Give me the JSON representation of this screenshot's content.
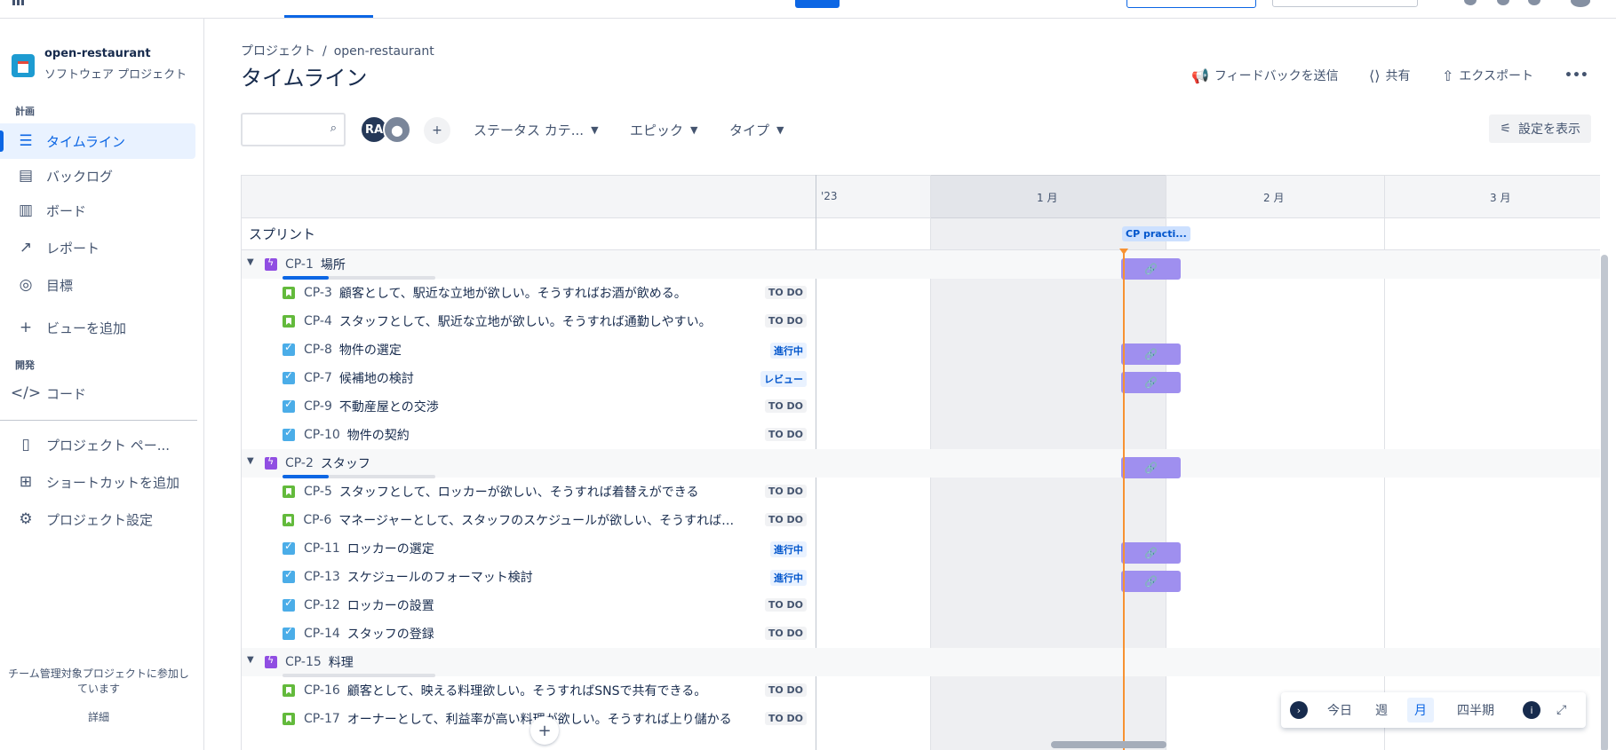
{
  "project": {
    "name": "open-restaurant",
    "type": "ソフトウェア プロジェクト"
  },
  "sidebar": {
    "section_plan": "計画",
    "section_dev": "開発",
    "items": [
      {
        "label": "タイムライン",
        "icon": "timeline-icon"
      },
      {
        "label": "バックログ",
        "icon": "backlog-icon"
      },
      {
        "label": "ボード",
        "icon": "board-icon"
      },
      {
        "label": "レポート",
        "icon": "reports-icon"
      },
      {
        "label": "目標",
        "icon": "goals-icon"
      },
      {
        "label": "ビューを追加",
        "icon": "plus-icon"
      },
      {
        "label": "コード",
        "icon": "code-icon"
      },
      {
        "label": "プロジェクト ペー...",
        "icon": "page-icon"
      },
      {
        "label": "ショートカットを追加",
        "icon": "add-shortcut-icon"
      },
      {
        "label": "プロジェクト設定",
        "icon": "gear-icon"
      }
    ],
    "footer_text": "チーム管理対象プロジェクトに参加しています",
    "footer_link": "詳細"
  },
  "header": {
    "breadcrumb_root": "プロジェクト",
    "breadcrumb_sep": "/",
    "breadcrumb_project": "open-restaurant",
    "title": "タイムライン",
    "feedback": "フィードバックを送信",
    "share": "共有",
    "export": "エクスポート",
    "more": "•••"
  },
  "filters": {
    "search_placeholder": "",
    "avatar_initials": "RA",
    "status_category": "ステータス カテ...",
    "epic": "エピック",
    "type": "タイプ",
    "show_settings": "設定を表示"
  },
  "timeline": {
    "months": [
      "'23",
      "1 月",
      "2 月",
      "3 月"
    ],
    "sprint_label": "スプリント",
    "sprint_chip": "CP practi...",
    "rows": [
      {
        "kind": "epic",
        "key": "CP-1",
        "summary": "場所",
        "progress": 0.3,
        "bar": true
      },
      {
        "kind": "story",
        "key": "CP-3",
        "summary": "顧客として、駅近な立地が欲しい。そうすればお酒が飲める。",
        "status": "TO DO",
        "status_kind": "todo",
        "bar": false
      },
      {
        "kind": "story",
        "key": "CP-4",
        "summary": "スタッフとして、駅近な立地が欲しい。そうすれば通勤しやすい。",
        "status": "TO DO",
        "status_kind": "todo",
        "bar": false
      },
      {
        "kind": "task",
        "key": "CP-8",
        "summary": "物件の選定",
        "status": "進行中",
        "status_kind": "progress-s",
        "bar": true
      },
      {
        "kind": "task",
        "key": "CP-7",
        "summary": "候補地の検討",
        "status": "レビュー",
        "status_kind": "review",
        "bar": true
      },
      {
        "kind": "task",
        "key": "CP-9",
        "summary": "不動産屋との交渉",
        "status": "TO DO",
        "status_kind": "todo",
        "bar": false
      },
      {
        "kind": "task",
        "key": "CP-10",
        "summary": "物件の契約",
        "status": "TO DO",
        "status_kind": "todo",
        "bar": false
      },
      {
        "kind": "epic",
        "key": "CP-2",
        "summary": "スタッフ",
        "progress": 0.3,
        "bar": true
      },
      {
        "kind": "story",
        "key": "CP-5",
        "summary": "スタッフとして、ロッカーが欲しい、そうすれば着替えができる",
        "status": "TO DO",
        "status_kind": "todo",
        "bar": false
      },
      {
        "kind": "story",
        "key": "CP-6",
        "summary": "マネージャーとして、スタッフのスケジュールが欲しい、そうすれば誰が...",
        "status": "TO DO",
        "status_kind": "todo",
        "bar": false
      },
      {
        "kind": "task",
        "key": "CP-11",
        "summary": "ロッカーの選定",
        "status": "進行中",
        "status_kind": "progress-s",
        "bar": true
      },
      {
        "kind": "task",
        "key": "CP-13",
        "summary": "スケジュールのフォーマット検討",
        "status": "進行中",
        "status_kind": "progress-s",
        "bar": true
      },
      {
        "kind": "task",
        "key": "CP-12",
        "summary": "ロッカーの設置",
        "status": "TO DO",
        "status_kind": "todo",
        "bar": false
      },
      {
        "kind": "task",
        "key": "CP-14",
        "summary": "スタッフの登録",
        "status": "TO DO",
        "status_kind": "todo",
        "bar": false
      },
      {
        "kind": "epic",
        "key": "CP-15",
        "summary": "料理",
        "progress": 0,
        "bar": false
      },
      {
        "kind": "story",
        "key": "CP-16",
        "summary": "顧客として、映える料理欲しい。そうすればSNSで共有できる。",
        "status": "TO DO",
        "status_kind": "todo",
        "bar": false
      },
      {
        "kind": "story",
        "key": "CP-17",
        "summary": "オーナーとして、利益率が高い料理が欲しい。そうすれば上り儲かる",
        "status": "TO DO",
        "status_kind": "todo",
        "bar": false
      }
    ]
  },
  "zoom": {
    "today": "今日",
    "week": "週",
    "month": "月",
    "quarter": "四半期"
  },
  "icons": {
    "bar_link": "link-icon",
    "chevron": "chevron-down-icon"
  },
  "colors": {
    "accent": "#0c66e4",
    "epic": "#904ee2",
    "story": "#63ba3c",
    "task": "#4bade8",
    "bar": "#9f8fef",
    "today": "#f79232"
  }
}
